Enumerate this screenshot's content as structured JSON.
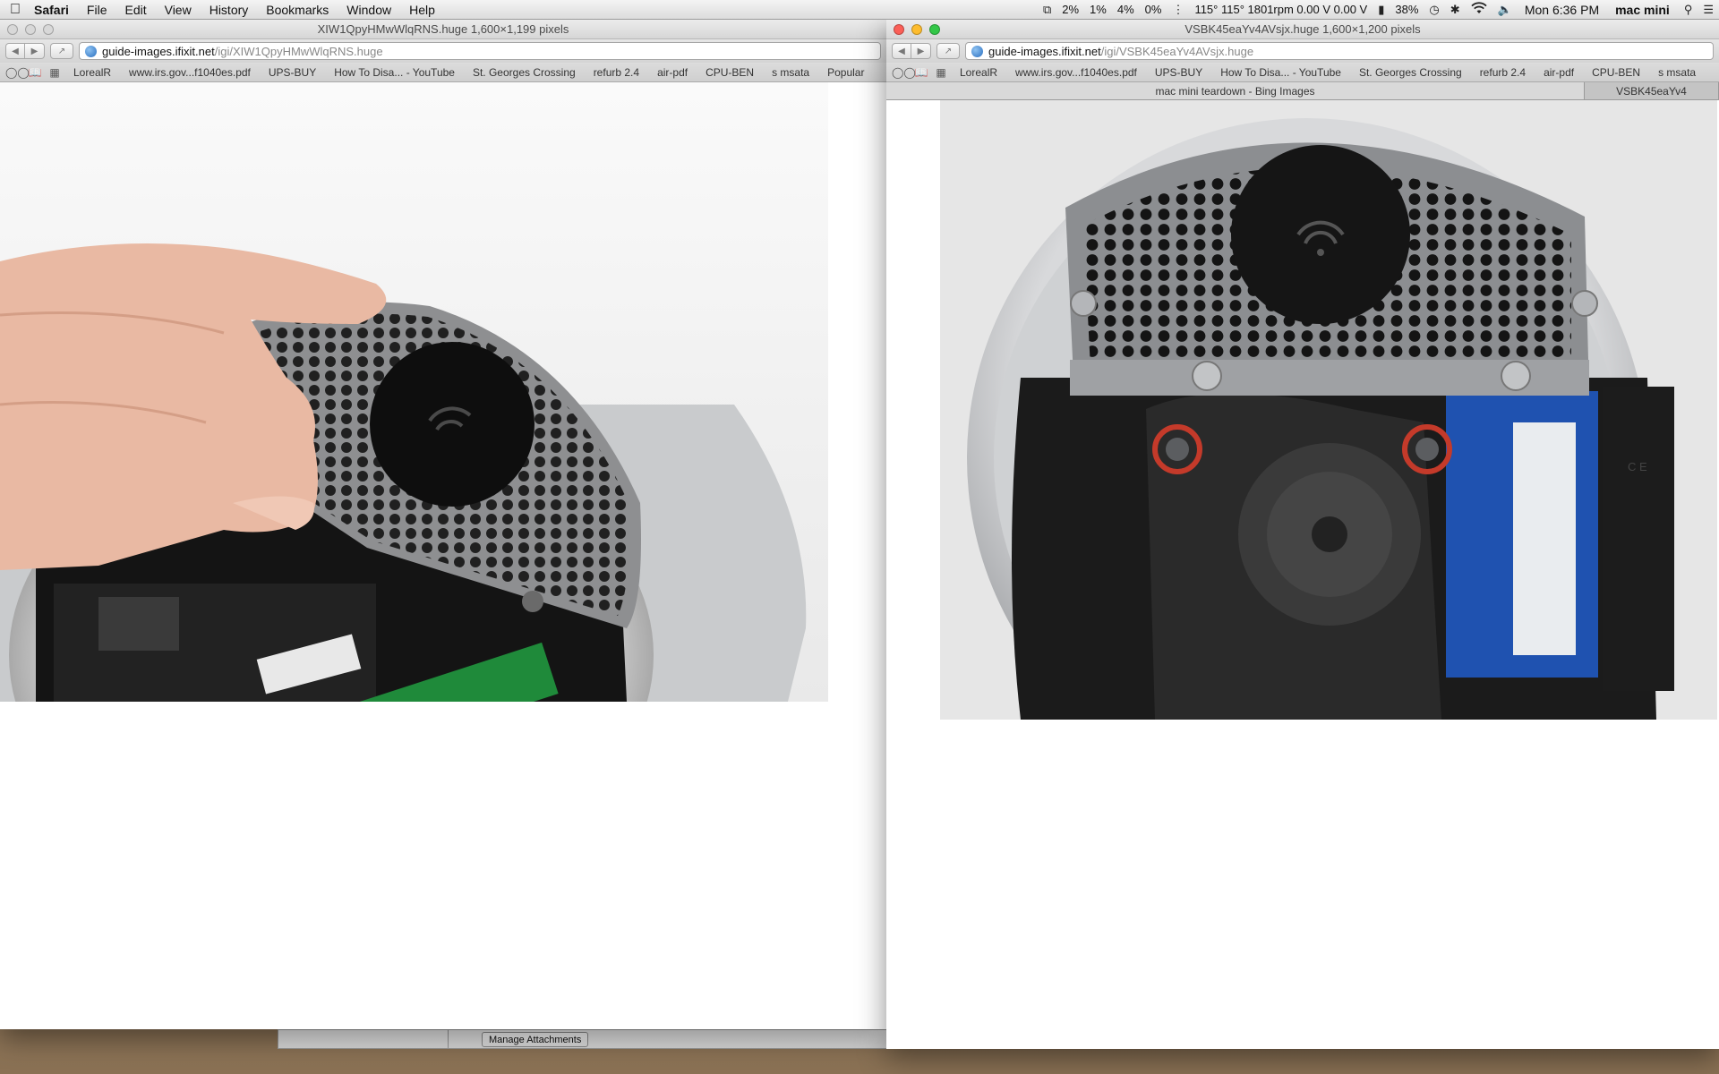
{
  "menubar": {
    "app_name": "Safari",
    "items": [
      "File",
      "Edit",
      "View",
      "History",
      "Bookmarks",
      "Window",
      "Help"
    ],
    "status": {
      "cpu1": "2%",
      "cpu2": "1%",
      "cpu3": "4%",
      "cpu4": "0%",
      "sensors": "115° 115° 1801rpm 0.00 V 0.00 V",
      "battery": "38%",
      "clock": "Mon 6:36 PM",
      "user": "mac mini"
    }
  },
  "left_window": {
    "title": "XIW1QpyHMwWlqRNS.huge 1,600×1,199 pixels",
    "url_host": "guide-images.ifixit.net",
    "url_path": "/igi/XIW1QpyHMwWlqRNS.huge",
    "bookmarks": [
      "LorealR",
      "www.irs.gov...f1040es.pdf",
      "UPS-BUY",
      "How To Disa... - YouTube",
      "St. Georges Crossing",
      "refurb 2.4",
      "air-pdf",
      "CPU-BEN",
      "s msata",
      "Popular"
    ]
  },
  "right_window": {
    "title": "VSBK45eaYv4AVsjx.huge 1,600×1,200 pixels",
    "url_host": "guide-images.ifixit.net",
    "url_path": "/igi/VSBK45eaYv4AVsjx.huge",
    "bookmarks": [
      "LorealR",
      "www.irs.gov...f1040es.pdf",
      "UPS-BUY",
      "How To Disa... - YouTube",
      "St. Georges Crossing",
      "refurb 2.4",
      "air-pdf",
      "CPU-BEN",
      "s msata"
    ],
    "tabs": [
      "mac mini teardown - Bing Images",
      "VSBK45eaYv4"
    ]
  },
  "background": {
    "manage_button": "Manage Attachments"
  },
  "colors": {
    "highlight_ring": "#c43a2a",
    "ram_board": "#1f52b0",
    "ram_board_left": "#1f8a3a"
  }
}
